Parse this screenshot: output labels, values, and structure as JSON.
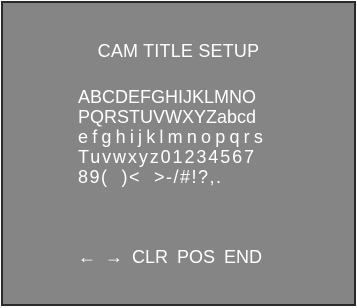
{
  "screen": {
    "title": "CAM TITLE SETUP"
  },
  "char_rows": [
    "ABCDEFGHIJKLMNO",
    "PQRSTUVWXYZabcd",
    "efghijklmnopqrs",
    "Tuvwxyz01234567",
    "89(  )<  >-/#!?,."
  ],
  "controls": {
    "left_arrow": "←",
    "right_arrow": "→",
    "clear": "CLR",
    "position": "POS",
    "end": "END"
  },
  "colors": {
    "panel_background": "#858585",
    "panel_border": "#2a2a2a",
    "text": "#ffffff"
  }
}
